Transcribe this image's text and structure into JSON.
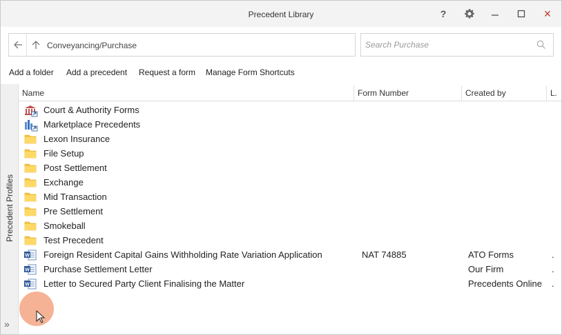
{
  "window": {
    "title": "Precedent Library"
  },
  "titlebar": {
    "help": "?",
    "close": "×"
  },
  "address": {
    "path": "Conveyancing/Purchase"
  },
  "search": {
    "placeholder": "Search Purchase"
  },
  "actions": [
    "Add a folder",
    "Add a precedent",
    "Request a form",
    "Manage Form Shortcuts"
  ],
  "sidebar": {
    "label": "Precedent Profiles",
    "expand": "»"
  },
  "columns": {
    "name": "Name",
    "form_number": "Form Number",
    "created_by": "Created by",
    "last": "L."
  },
  "rows": [
    {
      "name": "Court & Authority Forms",
      "form": "",
      "creator": "",
      "last": "",
      "icon": "court-forms-icon"
    },
    {
      "name": "Marketplace Precedents",
      "form": "",
      "creator": "",
      "last": "",
      "icon": "marketplace-icon"
    },
    {
      "name": "Lexon Insurance",
      "form": "",
      "creator": "",
      "last": "",
      "icon": "folder-icon"
    },
    {
      "name": "File Setup",
      "form": "",
      "creator": "",
      "last": "",
      "icon": "folder-icon"
    },
    {
      "name": "Post Settlement",
      "form": "",
      "creator": "",
      "last": "",
      "icon": "folder-icon"
    },
    {
      "name": "Exchange",
      "form": "",
      "creator": "",
      "last": "",
      "icon": "folder-icon"
    },
    {
      "name": "Mid Transaction",
      "form": "",
      "creator": "",
      "last": "",
      "icon": "folder-icon"
    },
    {
      "name": "Pre Settlement",
      "form": "",
      "creator": "",
      "last": "",
      "icon": "folder-icon"
    },
    {
      "name": "Smokeball",
      "form": "",
      "creator": "",
      "last": "",
      "icon": "folder-icon"
    },
    {
      "name": "Test Precedent",
      "form": "",
      "creator": "",
      "last": "",
      "icon": "folder-icon"
    },
    {
      "name": "Foreign Resident Capital Gains Withholding Rate Variation Application",
      "form": "NAT 74885",
      "creator": "ATO Forms",
      "last": ".",
      "icon": "word-doc-icon"
    },
    {
      "name": "Purchase Settlement Letter",
      "form": "",
      "creator": "Our Firm",
      "last": ".",
      "icon": "word-doc-icon"
    },
    {
      "name": "Letter to Secured Party Client Finalising the Matter",
      "form": "",
      "creator": "Precedents Online",
      "last": ".",
      "icon": "word-doc-icon"
    }
  ],
  "colors": {
    "folder": "#f5c542",
    "word": "#2b5797",
    "court": "#c0504d",
    "cursor_halo": "#f4a582"
  }
}
